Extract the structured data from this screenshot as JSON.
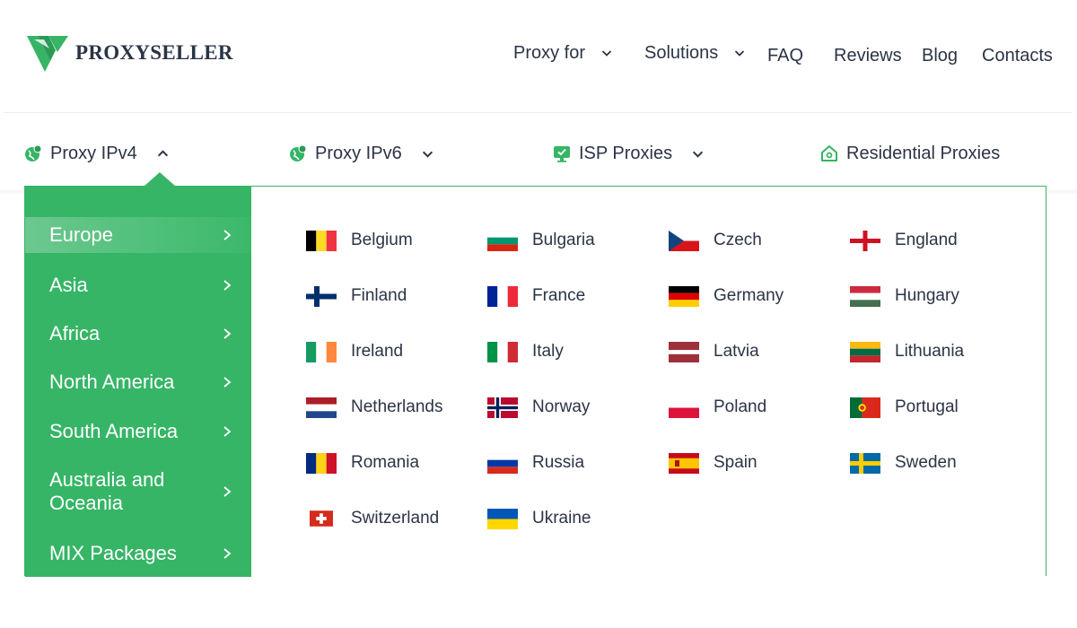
{
  "brand": {
    "name": "PROXYSELLER",
    "accent": "#36b566"
  },
  "topnav": {
    "proxy_for": "Proxy for",
    "solutions": "Solutions",
    "faq": "FAQ",
    "reviews": "Reviews",
    "blog": "Blog",
    "contacts": "Contacts"
  },
  "subnav": {
    "ipv4": "Proxy IPv4",
    "ipv6": "Proxy IPv6",
    "isp": "ISP Proxies",
    "residential": "Residential Proxies"
  },
  "regions": [
    {
      "label": "Europe",
      "active": true
    },
    {
      "label": "Asia"
    },
    {
      "label": "Africa"
    },
    {
      "label": "North America"
    },
    {
      "label": "South America"
    },
    {
      "label": "Australia and Oceania"
    },
    {
      "label": "MIX Packages"
    }
  ],
  "countries": [
    "Belgium",
    "Bulgaria",
    "Czech",
    "England",
    "Finland",
    "France",
    "Germany",
    "Hungary",
    "Ireland",
    "Italy",
    "Latvia",
    "Lithuania",
    "Netherlands",
    "Norway",
    "Poland",
    "Portugal",
    "Romania",
    "Russia",
    "Spain",
    "Sweden",
    "Switzerland",
    "Ukraine"
  ]
}
